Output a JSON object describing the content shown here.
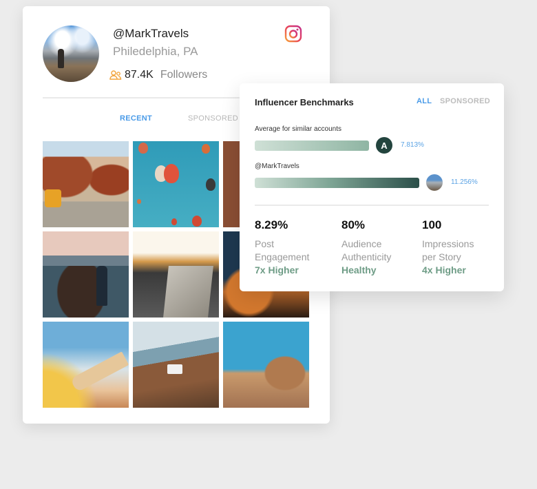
{
  "profile": {
    "handle": "@MarkTravels",
    "location": "Philedelphia, PA",
    "followers_count": "87.4K",
    "followers_label": "Followers",
    "platform_icon": "instagram-icon",
    "tabs": [
      {
        "label": "RECENT",
        "active": true
      },
      {
        "label": "SPONSORED",
        "active": false
      }
    ],
    "photos": [
      {
        "subject": "desert road with yellow van"
      },
      {
        "subject": "hot air balloons in blue sky"
      },
      {
        "subject": "red rock canyon road"
      },
      {
        "subject": "hiker on coastal rocks"
      },
      {
        "subject": "map on car dashboard at sunrise"
      },
      {
        "subject": "camping under starry sky"
      },
      {
        "subject": "airplane wing above clouds"
      },
      {
        "subject": "camper van on coastal cliff"
      },
      {
        "subject": "person lying beside camel in desert"
      }
    ]
  },
  "benchmarks": {
    "title": "Influencer Benchmarks",
    "tabs": [
      {
        "label": "ALL",
        "active": true
      },
      {
        "label": "SPONSORED",
        "active": false
      }
    ],
    "rows": [
      {
        "label": "Average for similar accounts",
        "value": "7.813%",
        "fraction": 0.694,
        "avatar": "brand-logo",
        "avatar_letter": "A"
      },
      {
        "label": "@MarkTravels",
        "value": "11.256%",
        "fraction": 1.0,
        "avatar": "user-avatar"
      }
    ],
    "stats": [
      {
        "value": "8.29%",
        "label_line1": "Post",
        "label_line2": "Engagement",
        "sub": "7x Higher"
      },
      {
        "value": "80%",
        "label_line1": "Audience",
        "label_line2": "Authenticity",
        "sub": "Healthy"
      },
      {
        "value": "100",
        "label_line1": "Impressions",
        "label_line2": "per Story",
        "sub": "4x Higher"
      }
    ]
  },
  "colors": {
    "accent_blue": "#4a9be8",
    "positive_green": "#6e9c86",
    "followers_icon_orange": "#f2a33a",
    "brand_dark_green": "#23443e"
  }
}
